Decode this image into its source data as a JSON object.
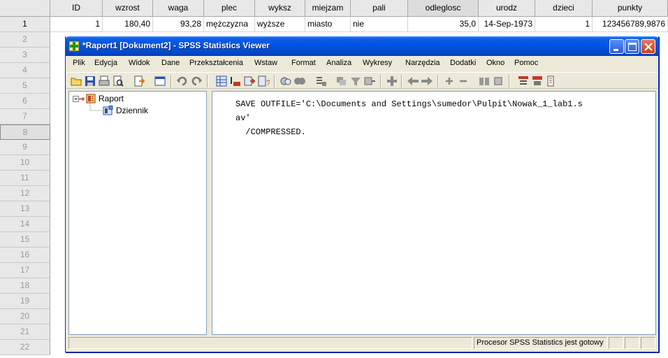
{
  "grid": {
    "columns": [
      "ID",
      "wzrost",
      "waga",
      "plec",
      "wyksz",
      "miejzam",
      "pali",
      "odleglosc",
      "urodz",
      "dzieci",
      "punkty"
    ],
    "row_numbers": [
      "1",
      "2",
      "3",
      "4",
      "5",
      "6",
      "7",
      "8",
      "9",
      "10",
      "11",
      "12",
      "13",
      "14",
      "15",
      "16",
      "17",
      "18",
      "19",
      "20",
      "21",
      "22"
    ],
    "row1": [
      "1",
      "180,40",
      "93,28",
      "mężczyzna",
      "wyższe",
      "miasto",
      "nie",
      "35,0",
      "14-Sep-1973",
      "1",
      "123456789,9876"
    ]
  },
  "viewer": {
    "title": "*Raport1 [Dokument2] - SPSS Statistics Viewer",
    "menu": [
      "Plik",
      "Edycja",
      "Widok",
      "Dane",
      "Przekształcenia",
      "Wstaw",
      "Format",
      "Analiza",
      "Wykresy",
      "Narzędzia",
      "Dodatki",
      "Okno",
      "Pomoc"
    ],
    "toolbar_icons": [
      "open-icon",
      "save-icon",
      "print-icon",
      "print-preview-icon",
      "export-icon",
      "goto-data-icon",
      "undo-icon",
      "redo-icon",
      "variables-icon",
      "go-to-case-icon",
      "insert-output-icon",
      "info-icon",
      "select-cases-icon",
      "value-labels-icon",
      "designate-window-icon",
      "outline-promote-icon",
      "show-hide-icon",
      "insert-heading-icon",
      "insert-title-icon",
      "insert-text-icon",
      "back-icon",
      "forward-icon",
      "expand-icon",
      "collapse-icon",
      "show-icon",
      "hide-icon",
      "insert-new-heading-icon",
      "insert-new-title-icon",
      "insert-new-text-icon"
    ],
    "outline": {
      "root": "Raport",
      "child": "Dziennik"
    },
    "content_lines": [
      "SAVE OUTFILE='C:\\Documents and Settings\\sumedor\\Pulpit\\Nowak_1_lab1.s",
      "av'",
      "  /COMPRESSED."
    ],
    "status": "Procesor SPSS Statistics  jest gotowy"
  },
  "colors": {
    "title_bar": "#0053e0",
    "window_bg": "#ece9d8",
    "grid_header": "#e8e8e8"
  }
}
